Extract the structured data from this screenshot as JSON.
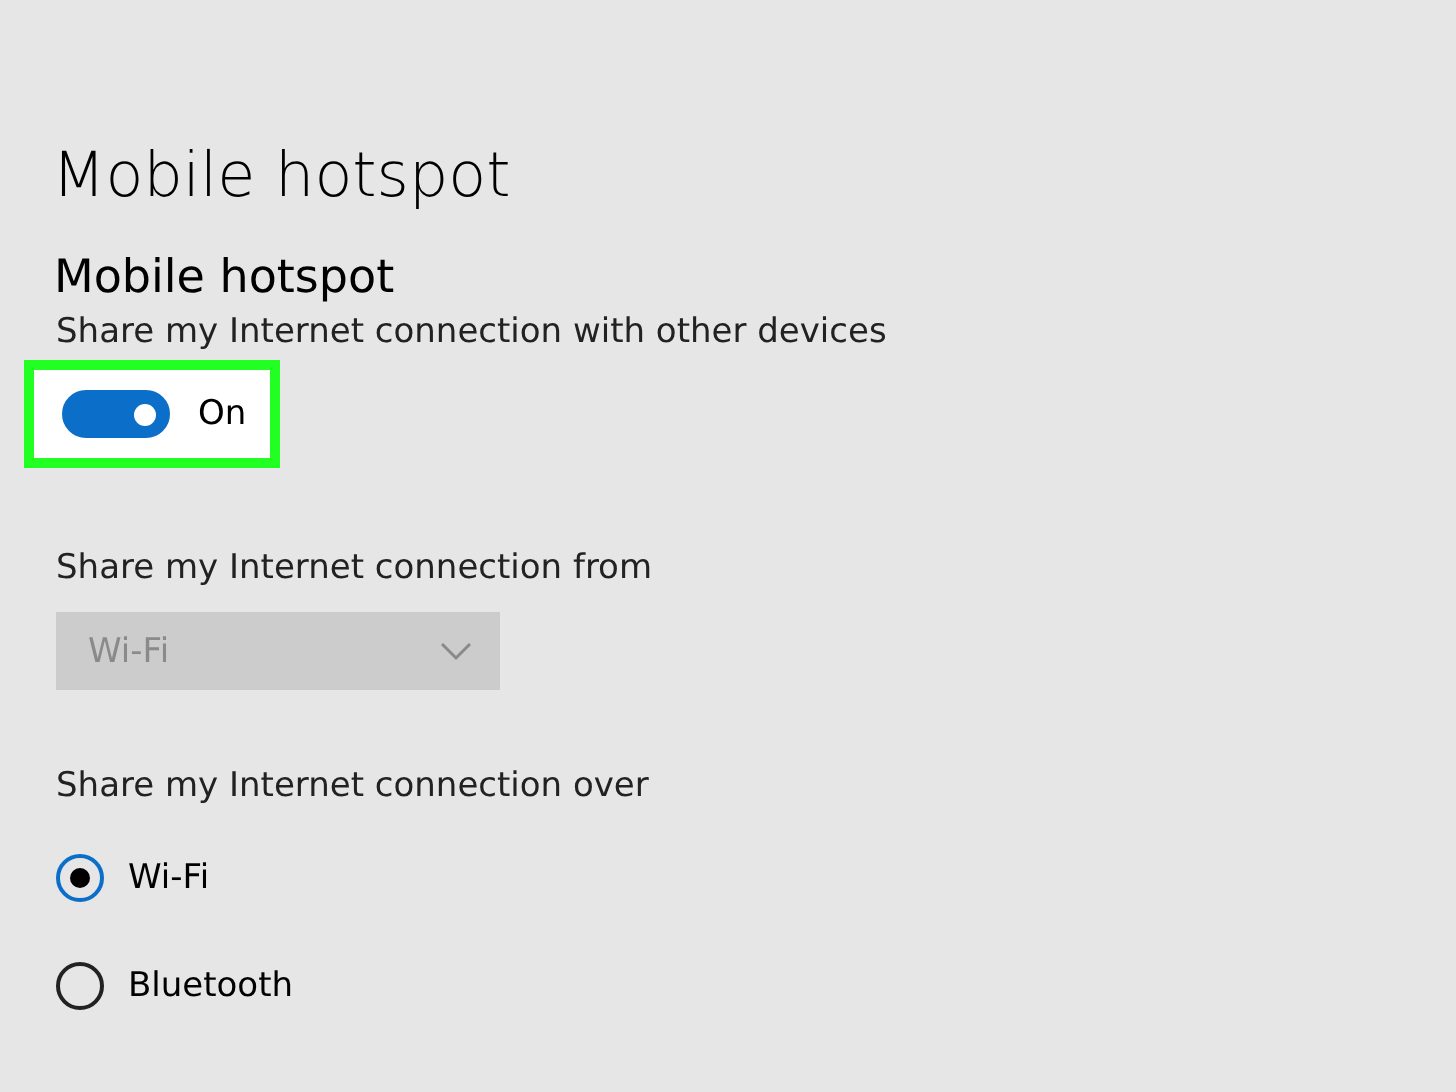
{
  "page_title": "Mobile hotspot",
  "section": {
    "heading": "Mobile hotspot",
    "description": "Share my Internet connection with other devices"
  },
  "toggle": {
    "on": true,
    "label": "On",
    "highlighted": true
  },
  "share_from": {
    "label": "Share my Internet connection from",
    "value": "Wi-Fi",
    "disabled": true
  },
  "share_over": {
    "label": "Share my Internet connection over",
    "options": [
      {
        "label": "Wi-Fi",
        "selected": true
      },
      {
        "label": "Bluetooth",
        "selected": false
      }
    ]
  }
}
